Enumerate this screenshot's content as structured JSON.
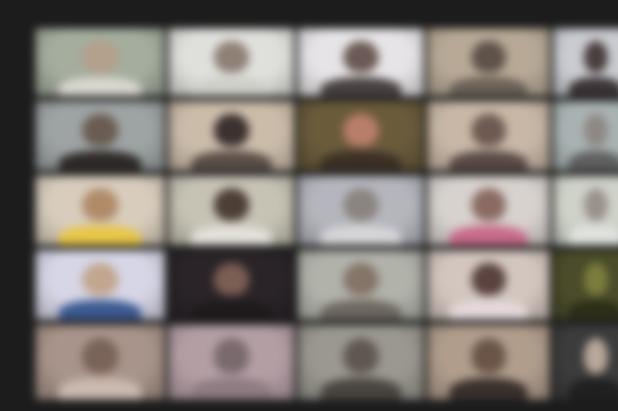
{
  "meeting": {
    "layout": "gallery",
    "participant_tiles": [
      {
        "row": 1,
        "col": 1,
        "bg": "#a4ad9e",
        "skin": "#b5a08c",
        "shirt": "#d9d8cf"
      },
      {
        "row": 1,
        "col": 2,
        "bg": "#dfe0dc",
        "skin": "#8f8076",
        "shirt": "#cfcfc9"
      },
      {
        "row": 1,
        "col": 3,
        "bg": "#e6e4e6",
        "skin": "#6b5a55",
        "shirt": "#4a4242"
      },
      {
        "row": 1,
        "col": 4,
        "bg": "#b7a996",
        "skin": "#5e524a",
        "shirt": "#6c6158"
      },
      {
        "row": 1,
        "col": 5,
        "bg": "#c9cbd1",
        "skin": "#4a3e3e",
        "shirt": "#3c3436"
      },
      {
        "row": 2,
        "col": 1,
        "bg": "#9ea4a4",
        "skin": "#6a5c52",
        "shirt": "#2e2a28"
      },
      {
        "row": 2,
        "col": 2,
        "bg": "#cbbcaa",
        "skin": "#3d3130",
        "shirt": "#5b4e48"
      },
      {
        "row": 2,
        "col": 3,
        "bg": "#6a5b3b",
        "skin": "#b97e6a",
        "shirt": "#3c3025"
      },
      {
        "row": 2,
        "col": 4,
        "bg": "#c8b7a6",
        "skin": "#6e5a52",
        "shirt": "#5a4a46"
      },
      {
        "row": 2,
        "col": 5,
        "bg": "#a9b2b2",
        "skin": "#8e8883",
        "shirt": "#5f6060"
      },
      {
        "row": 3,
        "col": 1,
        "bg": "#d8cdbd",
        "skin": "#b08b6a",
        "shirt": "#e8c648"
      },
      {
        "row": 3,
        "col": 2,
        "bg": "#c6c2b4",
        "skin": "#4d3e36",
        "shirt": "#e4e0da"
      },
      {
        "row": 3,
        "col": 3,
        "bg": "#b5b6bd",
        "skin": "#8b847f",
        "shirt": "#d6d6d8"
      },
      {
        "row": 3,
        "col": 4,
        "bg": "#d7d2ce",
        "skin": "#8a6b63",
        "shirt": "#c86b8a"
      },
      {
        "row": 3,
        "col": 5,
        "bg": "#cfd2c8",
        "skin": "#98918c",
        "shirt": "#e0e2de"
      },
      {
        "row": 4,
        "col": 1,
        "bg": "#d6d6e6",
        "skin": "#c2a68e",
        "shirt": "#3c5a92"
      },
      {
        "row": 4,
        "col": 2,
        "bg": "#2a2428",
        "skin": "#7b5e54",
        "shirt": "#1e1a1c"
      },
      {
        "row": 4,
        "col": 3,
        "bg": "#b1b2aa",
        "skin": "#857468",
        "shirt": "#6e685f"
      },
      {
        "row": 4,
        "col": 4,
        "bg": "#d2c6be",
        "skin": "#5a4340",
        "shirt": "#e4d8da"
      },
      {
        "row": 4,
        "col": 5,
        "bg": "#4a4c2a",
        "skin": "#7b7d3e",
        "shirt": "#2e2e18"
      },
      {
        "row": 5,
        "col": 1,
        "bg": "#a8948a",
        "skin": "#7a6358",
        "shirt": "#cbbab0"
      },
      {
        "row": 5,
        "col": 2,
        "bg": "#b39ea4",
        "skin": "#7a6a6e",
        "shirt": "#8e7c82"
      },
      {
        "row": 5,
        "col": 3,
        "bg": "#9a9890",
        "skin": "#605850",
        "shirt": "#4a4540"
      },
      {
        "row": 5,
        "col": 4,
        "bg": "#b09d8c",
        "skin": "#6b5548",
        "shirt": "#3a302c"
      },
      {
        "row": 5,
        "col": 5,
        "bg": "#3c3c3c",
        "skin": "#b8a89a",
        "shirt": "#202020"
      }
    ]
  }
}
